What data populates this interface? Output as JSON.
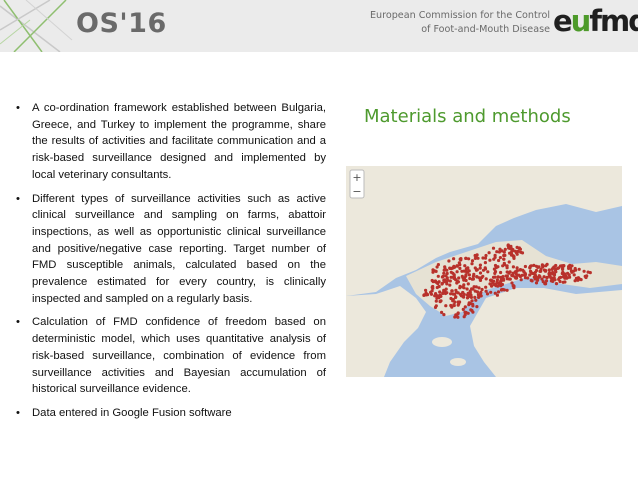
{
  "header": {
    "logo": "OS'16",
    "commission_line1": "European Commission for the Control",
    "commission_line2": "of Foot-and-Mouth Disease",
    "org_logo": "eufmd"
  },
  "section_title": "Materials and methods",
  "bullets": [
    "A co-ordination framework established between Bulgaria, Greece, and Turkey to implement the programme, share the results of activities and facilitate communication and a risk-based surveillance designed and implemented by local veterinary consultants.",
    "Different types of surveillance activities such as active clinical surveillance and sampling on farms, abattoir inspections, as well as opportunistic clinical surveillance and positive/negative case reporting. Target number of FMD susceptible animals, calculated based on the prevalence estimated for every country, is clinically inspected and sampled on a regularly basis.",
    "Calculation of FMD confidence of freedom based on deterministic model, which uses quantitative analysis of risk-based surveillance, combination of evidence from surveillance activities and Bayesian accumulation of historical surveillance evidence.",
    "Data entered in Google Fusion software"
  ],
  "colors": {
    "accent_green": "#4e9a2e",
    "header_bg": "#ebebeb",
    "sea": "#a9c4e4",
    "land": "#ece8dc",
    "marker": "#b8312b"
  },
  "map": {
    "type": "surveillance-points-map",
    "icon": "map-marker-icon"
  }
}
